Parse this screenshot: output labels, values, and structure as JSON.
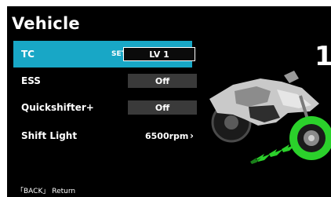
{
  "screen": {
    "title": "Vehicle",
    "big_value": "1"
  },
  "menu": {
    "items": [
      {
        "label": "TC",
        "set_tag": "SET",
        "value": "LV 1",
        "selected": true
      },
      {
        "label": "ESS",
        "value": "Off",
        "selected": false
      },
      {
        "label": "Quickshifter+",
        "value": "Off",
        "selected": false
      },
      {
        "label": "Shift Light",
        "value": "6500rpm",
        "selected": false
      }
    ]
  },
  "footer": {
    "hint": "「BACK」 Return"
  },
  "colors": {
    "accent": "#18a7c6",
    "wheel_highlight": "#2bd12b",
    "background": "#000000"
  },
  "icons": {
    "shift_light_arrow": "chevron-right-icon",
    "illustration": "motorcycle-traction-illustration"
  }
}
